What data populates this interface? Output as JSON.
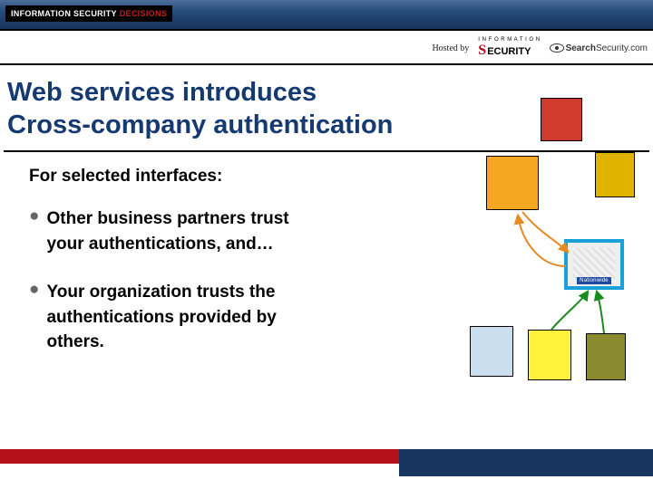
{
  "brand": {
    "name": "INFORMATION SECURITY",
    "accent": "DECISIONS"
  },
  "hosted_by": "Hosted by",
  "logos": {
    "security_small": "I N F O R M A T I O N",
    "security": "ECURITY",
    "searchsecurity_bold": "Search",
    "searchsecurity_rest": "Security.com"
  },
  "title": {
    "line1": "Web services introduces",
    "line2": "Cross-company authentication"
  },
  "subtitle": "For selected interfaces:",
  "bullets": [
    {
      "line1": "Other business partners trust",
      "line2": "your authentications, and…"
    },
    {
      "line1": "Your organization trusts the",
      "line2": "authentications  provided by",
      "line3": "others."
    }
  ],
  "diagram": {
    "center_label": "Nationwide",
    "boxes": [
      {
        "id": "red",
        "color": "#d13a2c"
      },
      {
        "id": "amber",
        "color": "#f5a623"
      },
      {
        "id": "dkyel",
        "color": "#e0b300"
      },
      {
        "id": "lblue",
        "color": "#c9dfef"
      },
      {
        "id": "yellow",
        "color": "#fff23a"
      },
      {
        "id": "olive",
        "color": "#8a8a2e"
      }
    ],
    "arrows": [
      {
        "from": "amber",
        "to": "center",
        "color": "#e68a1f"
      },
      {
        "from": "center",
        "to": "amber",
        "color": "#e68a1f"
      },
      {
        "from": "yellow",
        "to": "center",
        "color": "#1a8a1a"
      },
      {
        "from": "olive",
        "to": "center",
        "color": "#1a8a1a"
      }
    ]
  },
  "colors": {
    "title": "#153a72",
    "header_gradient_top": "#4c6d99",
    "header_gradient_bottom": "#17325a",
    "footer_red": "#b5111a",
    "footer_navy": "#17355f",
    "center_border": "#1aa0d8"
  }
}
